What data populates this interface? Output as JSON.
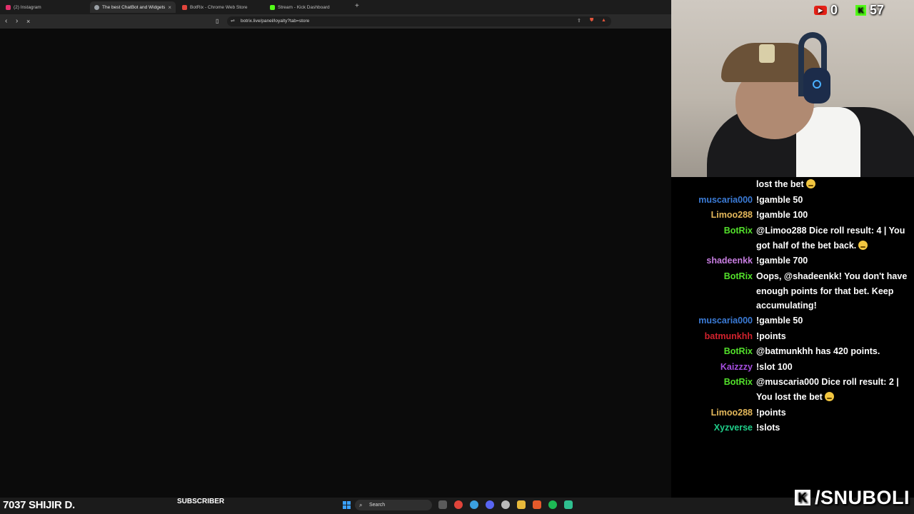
{
  "browser": {
    "tabs": [
      {
        "label": "(2) Instagram",
        "color": "#e1306c"
      },
      {
        "label": "The best ChatBot and Widgets f",
        "color": "#9aa0a6"
      },
      {
        "label": "BotRix - Chrome Web Store",
        "color": "#e2453c"
      },
      {
        "label": "Stream - Kick Dashboard",
        "color": "#53fc18"
      }
    ],
    "url": "botrix.live/panel/loyalty?tab=store"
  },
  "stream": {
    "youtube_count": "0",
    "kick_count": "57"
  },
  "chat": {
    "messages": [
      {
        "user": "",
        "user_color": "#ffffff",
        "text": "lost the bet",
        "emoji": true
      },
      {
        "user": "muscaria000",
        "user_color": "#3b7bd6",
        "text": "!gamble 50",
        "emoji": false
      },
      {
        "user": "Limoo288",
        "user_color": "#e4b85b",
        "text": "!gamble 100",
        "emoji": false
      },
      {
        "user": "BotRix",
        "user_color": "#53e02b",
        "text": "@Limoo288 Dice roll result: 4 | You got half of the bet back.",
        "emoji": true
      },
      {
        "user": "shadeenkk",
        "user_color": "#c77de0",
        "text": "!gamble 700",
        "emoji": false
      },
      {
        "user": "BotRix",
        "user_color": "#53e02b",
        "text": "Oops, @shadeenkk! You don't have enough points for that bet. Keep accumulating!",
        "emoji": false
      },
      {
        "user": "muscaria000",
        "user_color": "#3b7bd6",
        "text": "!gamble 50",
        "emoji": false
      },
      {
        "user": "batmunkhh",
        "user_color": "#d2222d",
        "text": "!points",
        "emoji": false
      },
      {
        "user": "BotRix",
        "user_color": "#53e02b",
        "text": "@batmunkhh has 420 points.",
        "emoji": false
      },
      {
        "user": "Kaizzzy",
        "user_color": "#a64ee0",
        "text": "!slot 100",
        "emoji": false
      },
      {
        "user": "BotRix",
        "user_color": "#53e02b",
        "text": "@muscaria000 Dice roll result: 2 | You lost the bet",
        "emoji": true
      },
      {
        "user": "Limoo288",
        "user_color": "#e4b85b",
        "text": "!points",
        "emoji": false
      },
      {
        "user": "Xyzverse",
        "user_color": "#1fcf8a",
        "text": "!slots",
        "emoji": false
      }
    ]
  },
  "bottom": {
    "left_text": "7037 SHIJIR D.",
    "subscriber_label": "SUBSCRIBER",
    "search_label": "Search",
    "brand": "/SNUBOLI"
  }
}
